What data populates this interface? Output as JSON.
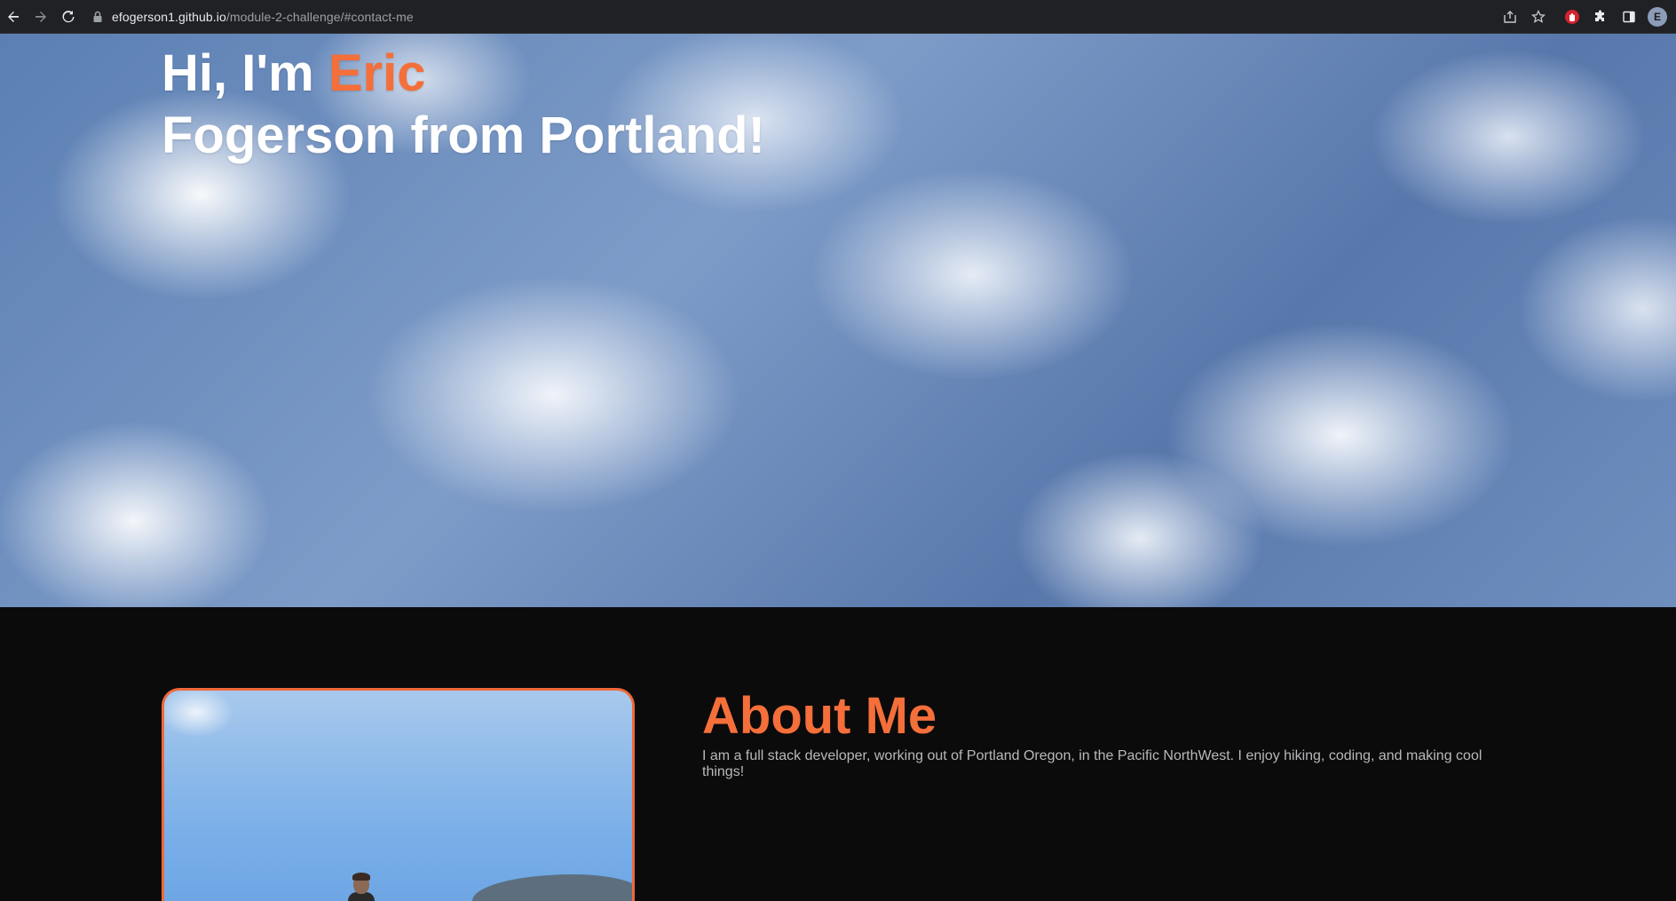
{
  "browser": {
    "url_host": "efogerson1.github.io",
    "url_path": "/module-2-challenge/#contact-me",
    "profile_initial": "E"
  },
  "hero": {
    "greeting": "Hi, I'm ",
    "first_name": "Eric",
    "line2": "Fogerson from Portland!"
  },
  "about": {
    "heading": "About Me",
    "text": "I am a full stack developer, working out of Portland Oregon, in the Pacific NorthWest. I enjoy hiking, coding, and making cool things!"
  },
  "colors": {
    "accent": "#f46f3a",
    "page_background": "#0b0b0c",
    "browser_bar": "#202124"
  },
  "icons": [
    "back-arrow-icon",
    "forward-arrow-icon",
    "reload-icon",
    "lock-icon",
    "share-icon",
    "star-icon",
    "extension-red-icon",
    "puzzle-icon",
    "sidebar-icon",
    "profile-avatar"
  ]
}
